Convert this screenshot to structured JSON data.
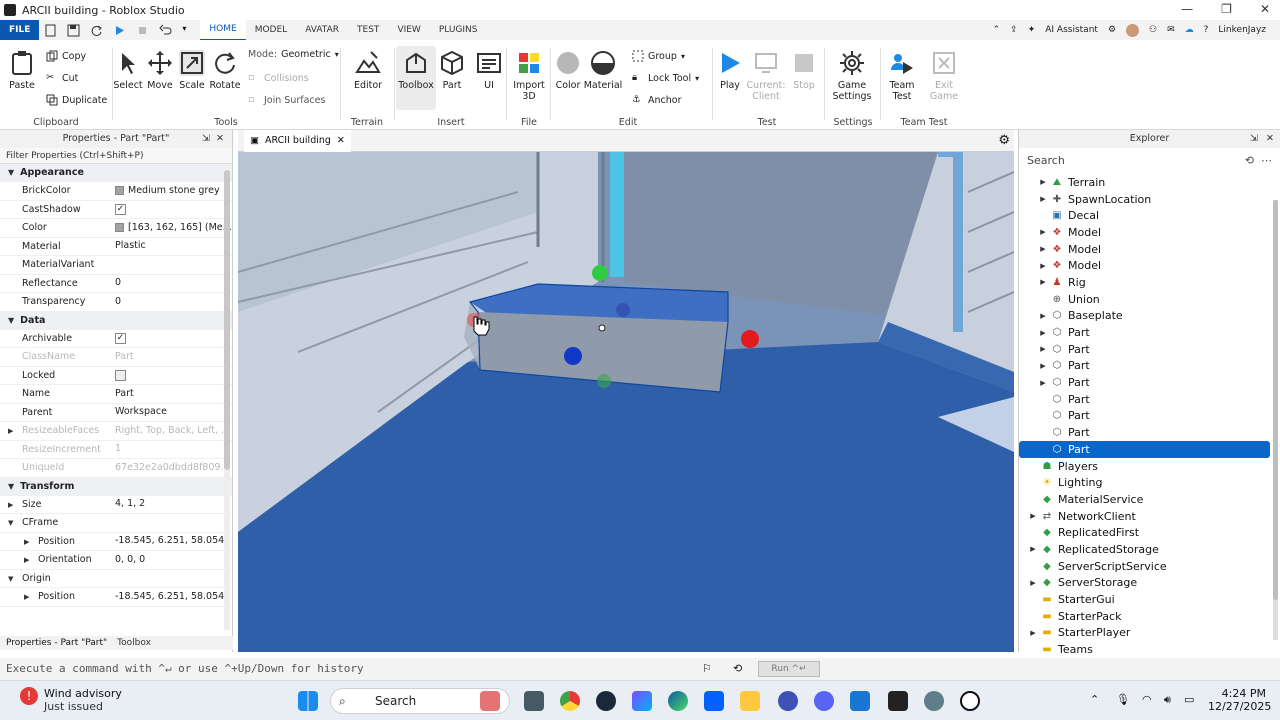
{
  "window": {
    "title": "ARCII building - Roblox Studio"
  },
  "menu": {
    "file": "FILE",
    "tabs": [
      "HOME",
      "MODEL",
      "AVATAR",
      "TEST",
      "VIEW",
      "PLUGINS"
    ],
    "active_tab": "HOME",
    "ai_assistant": "AI Assistant",
    "username": "LinkenJayz"
  },
  "ribbon": {
    "clipboard": {
      "label": "Clipboard",
      "paste": "Paste",
      "copy": "Copy",
      "cut": "Cut",
      "duplicate": "Duplicate"
    },
    "tools": {
      "label": "Tools",
      "select": "Select",
      "move": "Move",
      "scale": "Scale",
      "rotate": "Rotate",
      "mode_label": "Mode:",
      "mode_value": "Geometric",
      "collisions": "Collisions",
      "join_surfaces": "Join Surfaces"
    },
    "terrain": {
      "label": "Terrain",
      "editor": "Editor"
    },
    "insert": {
      "label": "Insert",
      "toolbox": "Toolbox",
      "part": "Part",
      "ui": "UI"
    },
    "file": {
      "label": "File",
      "import3d": "Import 3D"
    },
    "edit": {
      "label": "Edit",
      "color": "Color",
      "material": "Material",
      "group": "Group",
      "lock_tool": "Lock Tool",
      "anchor": "Anchor"
    },
    "test": {
      "label": "Test",
      "play": "Play",
      "current_client": "Current: Client",
      "stop": "Stop"
    },
    "settings": {
      "label": "Settings",
      "game_settings": "Game Settings"
    },
    "team_test": {
      "label": "Team Test",
      "team_test": "Team Test",
      "exit_game": "Exit Game"
    }
  },
  "properties": {
    "title": "Properties - Part \"Part\"",
    "filter_placeholder": "Filter Properties (Ctrl+Shift+P)",
    "sections": {
      "appearance": "Appearance",
      "data": "Data",
      "transform": "Transform"
    },
    "appearance": {
      "brickcolor": {
        "k": "BrickColor",
        "v": "Medium stone grey",
        "swatch": "#a3a2a5"
      },
      "castshadow": {
        "k": "CastShadow"
      },
      "color": {
        "k": "Color",
        "v": "[163, 162, 165] (Me...",
        "swatch": "#a3a2a5"
      },
      "material": {
        "k": "Material",
        "v": "Plastic"
      },
      "materialvariant": {
        "k": "MaterialVariant",
        "v": ""
      },
      "reflectance": {
        "k": "Reflectance",
        "v": "0"
      },
      "transparency": {
        "k": "Transparency",
        "v": "0"
      }
    },
    "data": {
      "archivable": {
        "k": "Archivable"
      },
      "classname": {
        "k": "ClassName",
        "v": "Part"
      },
      "locked": {
        "k": "Locked"
      },
      "name": {
        "k": "Name",
        "v": "Part"
      },
      "parent": {
        "k": "Parent",
        "v": "Workspace"
      },
      "resizeablefaces": {
        "k": "ResizeableFaces",
        "v": "Right, Top, Back, Left, ..."
      },
      "resizeincrement": {
        "k": "ResizeIncrement",
        "v": "1"
      },
      "uniqueid": {
        "k": "UniqueId",
        "v": "67e32e2a0dbdd8f809..."
      }
    },
    "transform": {
      "size": {
        "k": "Size",
        "v": "4, 1, 2"
      },
      "cframe": {
        "k": "CFrame"
      },
      "position": {
        "k": "Position",
        "v": "-18.545, 6.251, 58.054"
      },
      "orientation": {
        "k": "Orientation",
        "v": "0, 0, 0"
      },
      "origin": {
        "k": "Origin"
      },
      "origin_position": {
        "k": "Position",
        "v": "-18.545, 6.251, 58.054"
      }
    },
    "bottom_tabs": [
      "Properties - Part \"Part\"",
      "Toolbox"
    ]
  },
  "viewport": {
    "tab": "ARCII building"
  },
  "explorer": {
    "title": "Explorer",
    "search_placeholder": "Search",
    "items": [
      {
        "name": "Terrain",
        "icon": "terrain-icon",
        "color": "#2f9e44",
        "expandable": true,
        "child": true
      },
      {
        "name": "SpawnLocation",
        "icon": "spawn-icon",
        "color": "#555",
        "expandable": true,
        "child": true
      },
      {
        "name": "Decal",
        "icon": "decal-icon",
        "color": "#2f6fb0",
        "expandable": false,
        "child": true
      },
      {
        "name": "Model",
        "icon": "model-icon",
        "color": "#c0392b",
        "expandable": true,
        "child": true
      },
      {
        "name": "Model",
        "icon": "model-icon",
        "color": "#c0392b",
        "expandable": true,
        "child": true
      },
      {
        "name": "Model",
        "icon": "model-icon",
        "color": "#c0392b",
        "expandable": true,
        "child": true
      },
      {
        "name": "Rig",
        "icon": "rig-icon",
        "color": "#c0392b",
        "expandable": true,
        "child": true
      },
      {
        "name": "Union",
        "icon": "union-icon",
        "color": "#555",
        "expandable": false,
        "child": true
      },
      {
        "name": "Baseplate",
        "icon": "part-icon",
        "color": "#555",
        "expandable": true,
        "child": true
      },
      {
        "name": "Part",
        "icon": "part-icon",
        "color": "#555",
        "expandable": true,
        "child": true
      },
      {
        "name": "Part",
        "icon": "part-icon",
        "color": "#555",
        "expandable": true,
        "child": true
      },
      {
        "name": "Part",
        "icon": "part-icon",
        "color": "#555",
        "expandable": true,
        "child": true
      },
      {
        "name": "Part",
        "icon": "part-icon",
        "color": "#555",
        "expandable": true,
        "child": true
      },
      {
        "name": "Part",
        "icon": "part-icon",
        "color": "#555",
        "expandable": false,
        "child": true
      },
      {
        "name": "Part",
        "icon": "part-icon",
        "color": "#555",
        "expandable": false,
        "child": true
      },
      {
        "name": "Part",
        "icon": "part-icon",
        "color": "#555",
        "expandable": false,
        "child": true
      },
      {
        "name": "Part",
        "icon": "part-icon",
        "color": "#fff",
        "expandable": false,
        "child": true,
        "selected": true
      },
      {
        "name": "Players",
        "icon": "players-icon",
        "color": "#2f9e44",
        "expandable": false,
        "child": false
      },
      {
        "name": "Lighting",
        "icon": "lighting-icon",
        "color": "#e0b000",
        "expandable": false,
        "child": false
      },
      {
        "name": "MaterialService",
        "icon": "material-service-icon",
        "color": "#2f9e44",
        "expandable": false,
        "child": false
      },
      {
        "name": "NetworkClient",
        "icon": "network-icon",
        "color": "#555",
        "expandable": true,
        "child": false
      },
      {
        "name": "ReplicatedFirst",
        "icon": "replicated-first-icon",
        "color": "#2f9e44",
        "expandable": false,
        "child": false
      },
      {
        "name": "ReplicatedStorage",
        "icon": "replicated-storage-icon",
        "color": "#2f9e44",
        "expandable": true,
        "child": false
      },
      {
        "name": "ServerScriptService",
        "icon": "server-script-icon",
        "color": "#2f9e44",
        "expandable": false,
        "child": false
      },
      {
        "name": "ServerStorage",
        "icon": "server-storage-icon",
        "color": "#2f9e44",
        "expandable": true,
        "child": false
      },
      {
        "name": "StarterGui",
        "icon": "folder-icon",
        "color": "#e0b000",
        "expandable": false,
        "child": false
      },
      {
        "name": "StarterPack",
        "icon": "folder-icon",
        "color": "#e0b000",
        "expandable": false,
        "child": false
      },
      {
        "name": "StarterPlayer",
        "icon": "folder-icon",
        "color": "#e0b000",
        "expandable": true,
        "child": false
      },
      {
        "name": "Teams",
        "icon": "folder-icon",
        "color": "#e0b000",
        "expandable": false,
        "child": false
      }
    ]
  },
  "command_bar": {
    "placeholder": "Execute a command with ^↵ or use ^+Up/Down for history",
    "run": "Run ^↵"
  },
  "taskbar": {
    "weather_title": "Wind advisory",
    "weather_sub": "Just issued",
    "search": "Search",
    "time": "4:24 PM",
    "date": "12/27/2025"
  }
}
